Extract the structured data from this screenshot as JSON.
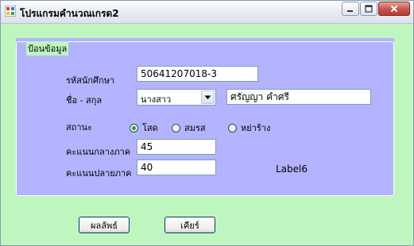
{
  "window": {
    "title": "โปรแกรมคำนวณเกรด2"
  },
  "groupbox": {
    "title": "ป้อนข้อมูล"
  },
  "form": {
    "student_id_label": "รหัสนักศึกษา",
    "student_id_value": "50641207018-3",
    "name_label": "ชื่อ - สกุล",
    "title_select_value": "นางสาว",
    "full_name_value": "ศรัญญา คำศรี",
    "status_label": "สถานะ",
    "status_options": [
      {
        "label": "โสด",
        "checked": true
      },
      {
        "label": "สมรส",
        "checked": false
      },
      {
        "label": "หย่าร้าง",
        "checked": false
      }
    ],
    "midterm_label": "คะแนนกลางภาค",
    "midterm_value": "45",
    "final_label": "คะแนนปลายภาค",
    "final_value": "40",
    "result_label": "Label6"
  },
  "buttons": {
    "result": "ผลลัพธ์",
    "clear": "เคียร์"
  },
  "colors": {
    "form_background": "#bff5bf",
    "group_background": "#b3b3ff"
  }
}
